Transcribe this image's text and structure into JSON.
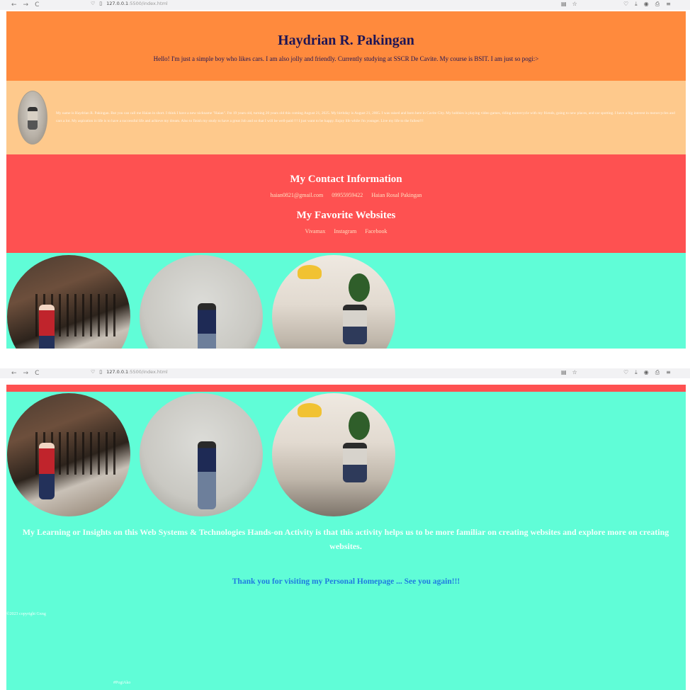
{
  "browser": {
    "back": "←",
    "forward": "→",
    "reload": "C",
    "url_host": "127.0.0.1",
    "url_rest": ":5500/index.html",
    "shield": "♡",
    "download": "⤓",
    "account": "◉",
    "extension": "⎙",
    "menu": "≡",
    "reader": "▤",
    "star": "☆"
  },
  "header": {
    "title": "Haydrian R. Pakingan",
    "tagline": "Hello! I'm just a simple boy who likes cars. I am also jolly and friendly. Currently studying at SSCR De Cavite. My course is BSIT. I am just so pogi:>"
  },
  "about": {
    "bio": "My name is Haydrian R. Pakingan. But you can call me Haian in short. I think I have a new nickname \"Haian\". I'm 19 years old, turning 20 years old this coming August 21, 2025. My birthday is August 21, 2005. I was raised and born here in Cavite City. My hobbies is playing video games, riding motorcycle with my friends, going to new places, and car spotting. I have a big interest in motorcycles and cars a lot. My aspiration in life is to have a successful life and achieve my dream. Also to finish my study to have a great Job and so that I will be well-paid !!! I just want to be happy. Enjoy life while i'm younger. Live my life to the fullest!!!"
  },
  "contact": {
    "heading": "My Contact Information",
    "email": "haian0821@gmail.com",
    "phone": "09955959422",
    "facebook_name": "Haian Rosal Pakingan"
  },
  "favorites": {
    "heading": "My Favorite Websites",
    "links": [
      "Vivamax",
      "Instagram",
      "Facebook"
    ]
  },
  "closing": {
    "insight": "My Learning or Insights on this Web Systems & Technologies Hands-on Activity is that this activity helps us to be more familiar on creating websites and explore more on creating websites.",
    "thanks": "Thank you for visiting my Personal Homepage ... See you again!!!",
    "footer_left": "©2023 copyright Gxng",
    "footer_right": "#PogiAko"
  },
  "colors": {
    "header_bg": "#ff8a3d",
    "about_bg": "#fec98c",
    "contact_bg": "#fe5151",
    "gallery_bg": "#60fdd7",
    "thanks_text": "#1f7be0"
  }
}
